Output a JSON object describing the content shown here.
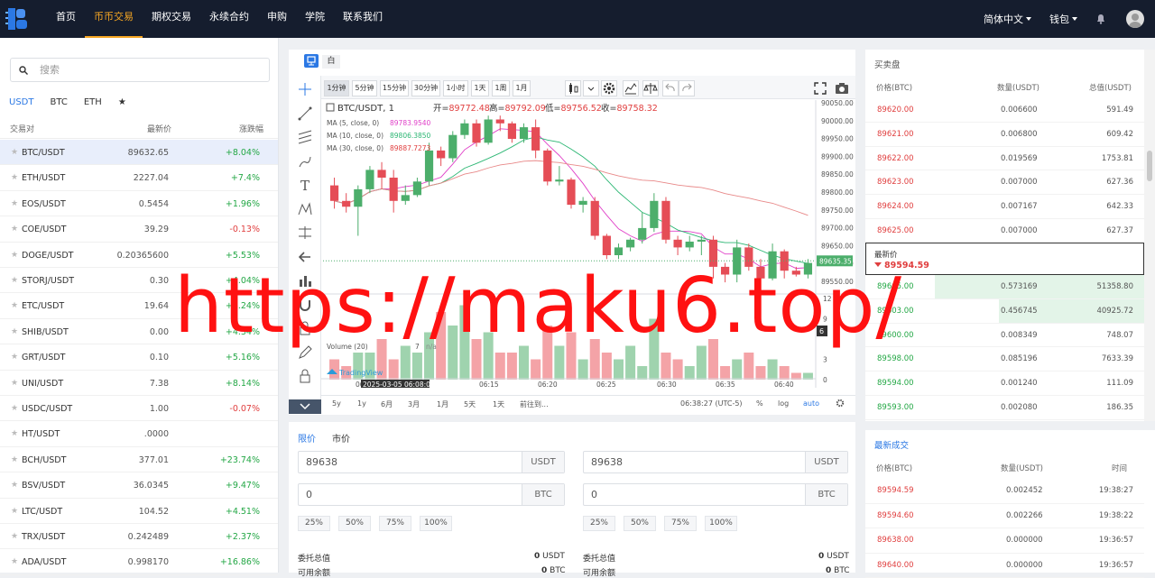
{
  "nav": {
    "links": [
      "首页",
      "币币交易",
      "期权交易",
      "永续合约",
      "申购",
      "学院",
      "联系我们"
    ],
    "active_index": 1,
    "language": "简体中文",
    "wallet": "钱包",
    "icons": [
      "logo-icon",
      "bell-icon",
      "avatar-icon"
    ]
  },
  "markets": {
    "search_placeholder": "搜索",
    "tabs": [
      "USDT",
      "BTC",
      "ETH",
      "★"
    ],
    "active_tab": 0,
    "headers": {
      "pair": "交易对",
      "price": "最新价",
      "change": "涨跌幅"
    },
    "rows": [
      {
        "pair": "BTC/USDT",
        "price": "89632.65",
        "change": "+8.04%",
        "dir": "up",
        "selected": true
      },
      {
        "pair": "ETH/USDT",
        "price": "2227.04",
        "change": "+7.4%",
        "dir": "up"
      },
      {
        "pair": "EOS/USDT",
        "price": "0.5454",
        "change": "+1.96%",
        "dir": "up"
      },
      {
        "pair": "COE/USDT",
        "price": "39.29",
        "change": "-0.13%",
        "dir": "dn"
      },
      {
        "pair": "DOGE/USDT",
        "price": "0.20365600",
        "change": "+5.53%",
        "dir": "up"
      },
      {
        "pair": "STORJ/USDT",
        "price": "0.30",
        "change": "+4.04%",
        "dir": "up"
      },
      {
        "pair": "ETC/USDT",
        "price": "19.64",
        "change": "+4.24%",
        "dir": "up"
      },
      {
        "pair": "SHIB/USDT",
        "price": "0.00",
        "change": "+4.34%",
        "dir": "up"
      },
      {
        "pair": "GRT/USDT",
        "price": "0.10",
        "change": "+5.16%",
        "dir": "up"
      },
      {
        "pair": "UNI/USDT",
        "price": "7.38",
        "change": "+8.14%",
        "dir": "up"
      },
      {
        "pair": "USDC/USDT",
        "price": "1.00",
        "change": "-0.07%",
        "dir": "dn"
      },
      {
        "pair": "HT/USDT",
        "price": ".0000",
        "change": "",
        "dir": "up"
      },
      {
        "pair": "BCH/USDT",
        "price": "377.01",
        "change": "+23.74%",
        "dir": "up"
      },
      {
        "pair": "BSV/USDT",
        "price": "36.0345",
        "change": "+9.47%",
        "dir": "up"
      },
      {
        "pair": "LTC/USDT",
        "price": "104.52",
        "change": "+4.51%",
        "dir": "up"
      },
      {
        "pair": "TRX/USDT",
        "price": "0.242489",
        "change": "+2.37%",
        "dir": "up"
      },
      {
        "pair": "ADA/USDT",
        "price": "0.998170",
        "change": "+16.86%",
        "dir": "up"
      }
    ]
  },
  "chart_toolbar": {
    "mode_label": "白",
    "intervals": [
      "1分钟",
      "5分钟",
      "15分钟",
      "30分钟",
      "1小时",
      "1天",
      "1周",
      "1月"
    ],
    "active_interval": 0,
    "symbol": "BTC/USDT, 1",
    "ohlc": {
      "open_label": "开=",
      "open": "89772.48",
      "high_label": "高=",
      "high": "89792.09",
      "low_label": "低=",
      "low": "89756.52",
      "close_label": "收=",
      "close": "89758.32"
    },
    "ma": [
      {
        "label": "MA (5, close, 0)",
        "value": "89783.9540",
        "color": "#e040c8"
      },
      {
        "label": "MA (10, close, 0)",
        "value": "89806.3850",
        "color": "#2bb673"
      },
      {
        "label": "MA (30, close, 0)",
        "value": "89887.7273",
        "color": "#e03e3e"
      }
    ],
    "volume_label": "Volume (20)",
    "volume_extra": "7",
    "volume_na": "n/a",
    "tv_logo": "TradingView",
    "price_tag": "89635.35",
    "vol_tag": "6",
    "crosshair_time": "2025-03-05 06:08:00",
    "time_ticks": [
      "06",
      "06:15",
      "06:20",
      "06:25",
      "06:30",
      "06:35",
      "06:40"
    ],
    "price_ticks": [
      "90050.00",
      "90000.00",
      "89950.00",
      "89900.00",
      "89850.00",
      "89800.00",
      "89750.00",
      "89700.00",
      "89650.00",
      "89600.00",
      "89550.00"
    ],
    "vol_ticks": [
      "12",
      "9",
      "3",
      "0"
    ],
    "ranges": [
      "5y",
      "1y",
      "6月",
      "3月",
      "1月",
      "5天",
      "1天"
    ],
    "goto": "前往到...",
    "clock": "06:38:27 (UTC-5)",
    "pct": "%",
    "log": "log",
    "auto": "auto"
  },
  "chart_data": {
    "type": "candlestick",
    "y_range": [
      89550,
      90050
    ],
    "candles": [
      [
        89830,
        89790,
        89850,
        89770
      ],
      [
        89790,
        89775,
        89810,
        89760
      ],
      [
        89775,
        89820,
        89830,
        89700
      ],
      [
        89820,
        89870,
        89880,
        89810
      ],
      [
        89870,
        89850,
        89890,
        89820
      ],
      [
        89850,
        89790,
        89870,
        89760
      ],
      [
        89790,
        89805,
        89830,
        89780
      ],
      [
        89805,
        89840,
        89850,
        89800
      ],
      [
        89840,
        89920,
        89940,
        89830
      ],
      [
        89920,
        89900,
        89930,
        89880
      ],
      [
        89900,
        89960,
        89970,
        89890
      ],
      [
        89960,
        89990,
        90000,
        89950
      ],
      [
        89990,
        89940,
        90000,
        89930
      ],
      [
        89940,
        90000,
        90010,
        89935
      ],
      [
        90000,
        89990,
        90010,
        89970
      ],
      [
        89990,
        89950,
        89995,
        89940
      ],
      [
        89950,
        89980,
        89990,
        89940
      ],
      [
        89980,
        89920,
        90000,
        89900
      ],
      [
        89920,
        89840,
        89925,
        89830
      ],
      [
        89840,
        89845,
        89880,
        89830
      ],
      [
        89845,
        89780,
        89850,
        89770
      ],
      [
        89780,
        89790,
        89800,
        89760
      ],
      [
        89790,
        89700,
        89800,
        89690
      ],
      [
        89700,
        89650,
        89705,
        89640
      ],
      [
        89650,
        89670,
        89680,
        89640
      ],
      [
        89670,
        89690,
        89695,
        89660
      ],
      [
        89690,
        89720,
        89760,
        89680
      ],
      [
        89720,
        89790,
        89810,
        89710
      ],
      [
        89790,
        89690,
        89800,
        89680
      ],
      [
        89690,
        89670,
        89700,
        89650
      ],
      [
        89670,
        89685,
        89700,
        89660
      ],
      [
        89685,
        89690,
        89700,
        89650
      ],
      [
        89690,
        89620,
        89700,
        89590
      ],
      [
        89620,
        89600,
        89630,
        89580
      ],
      [
        89600,
        89670,
        89690,
        89580
      ],
      [
        89670,
        89620,
        89680,
        89610
      ],
      [
        89620,
        89590,
        89640,
        89580
      ],
      [
        89590,
        89660,
        89680,
        89585
      ],
      [
        89660,
        89610,
        89665,
        89590
      ],
      [
        89610,
        89600,
        89620,
        89595
      ],
      [
        89600,
        89630,
        89640,
        89590
      ]
    ],
    "volumes": [
      3,
      2,
      4,
      4,
      6,
      3,
      5,
      4,
      7,
      10,
      8,
      11,
      6,
      7,
      4,
      4,
      5,
      3,
      8,
      5,
      7,
      3,
      6,
      4,
      3,
      5,
      2,
      9,
      4,
      3,
      2,
      5,
      6,
      2,
      3,
      4,
      2,
      3,
      2,
      1,
      1
    ]
  },
  "order_form": {
    "tabs": [
      "限价",
      "市价"
    ],
    "active_tab": 0,
    "buy": {
      "price": "89638",
      "price_unit": "USDT",
      "amount": "0",
      "amount_unit": "BTC"
    },
    "sell": {
      "price": "89638",
      "price_unit": "USDT",
      "amount": "0",
      "amount_unit": "BTC"
    },
    "percents": [
      "25%",
      "50%",
      "75%",
      "100%"
    ],
    "total_label": "委托总值",
    "total_value": "0",
    "total_unit": "USDT",
    "avail_label": "可用余额",
    "avail_value": "0",
    "avail_unit": "BTC"
  },
  "orderbook": {
    "title": "买卖盘",
    "headers": {
      "price": "价格(BTC)",
      "amount": "数量(USDT)",
      "total": "总值(USDT)"
    },
    "asks": [
      {
        "price": "89620.00",
        "amount": "0.006600",
        "total": "591.49"
      },
      {
        "price": "89621.00",
        "amount": "0.006800",
        "total": "609.42"
      },
      {
        "price": "89622.00",
        "amount": "0.019569",
        "total": "1753.81"
      },
      {
        "price": "89623.00",
        "amount": "0.007000",
        "total": "627.36"
      },
      {
        "price": "89624.00",
        "amount": "0.007167",
        "total": "642.33"
      },
      {
        "price": "89625.00",
        "amount": "0.007000",
        "total": "627.37"
      }
    ],
    "last_label": "最新价",
    "last_price": "89594.59",
    "bids": [
      {
        "price": "89605.00",
        "amount": "0.573169",
        "total": "51358.80",
        "depth": 0.75
      },
      {
        "price": "89603.00",
        "amount": "0.456745",
        "total": "40925.72",
        "depth": 0.52
      },
      {
        "price": "89600.00",
        "amount": "0.008349",
        "total": "748.07",
        "depth": 0
      },
      {
        "price": "89598.00",
        "amount": "0.085196",
        "total": "7633.39",
        "depth": 0
      },
      {
        "price": "89594.00",
        "amount": "0.001240",
        "total": "111.09",
        "depth": 0
      },
      {
        "price": "89593.00",
        "amount": "0.002080",
        "total": "186.35",
        "depth": 0
      }
    ]
  },
  "trades": {
    "title": "最新成交",
    "headers": {
      "price": "价格(BTC)",
      "amount": "数量(USDT)",
      "time": "时间"
    },
    "rows": [
      {
        "price": "89594.59",
        "amount": "0.002452",
        "time": "19:38:27"
      },
      {
        "price": "89594.60",
        "amount": "0.002266",
        "time": "19:38:22"
      },
      {
        "price": "89638.00",
        "amount": "0.000000",
        "time": "19:36:57"
      },
      {
        "price": "89640.00",
        "amount": "0.000000",
        "time": "19:36:57"
      }
    ]
  },
  "watermark": "https://maku6.top/",
  "colors": {
    "up": "#23a745",
    "down": "#e03e3e",
    "accent": "#2b78e4",
    "nav_active": "#f5a623"
  }
}
